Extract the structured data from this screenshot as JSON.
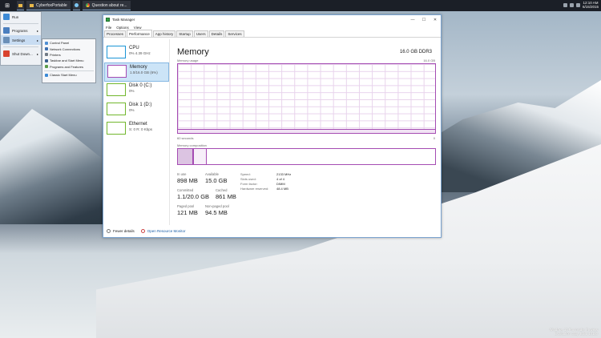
{
  "taskbar": {
    "items": [
      {
        "label": ""
      },
      {
        "label": "CyberfoxPortable"
      },
      {
        "label": "Question about re..."
      }
    ],
    "clock": {
      "time": "12:10 AM",
      "date": "6/15/2015"
    }
  },
  "start_menu": {
    "items": [
      {
        "label": "Run"
      },
      {
        "label": "Programs"
      },
      {
        "label": "Settings"
      },
      {
        "label": "Shut Down..."
      }
    ],
    "arrow": "▸",
    "settings_submenu": [
      {
        "label": "Control Panel"
      },
      {
        "label": "Network Connections"
      },
      {
        "label": "Printers"
      },
      {
        "label": "Taskbar and Start Menu"
      },
      {
        "label": "Programs and Features"
      },
      {
        "label": "Classic Start Menu"
      }
    ]
  },
  "task_manager": {
    "title": "Task Manager",
    "controls": {
      "minimize": "—",
      "maximize": "☐",
      "close": "✕"
    },
    "menu": [
      {
        "label": "File"
      },
      {
        "label": "Options"
      },
      {
        "label": "View"
      }
    ],
    "tabs": [
      {
        "label": "Processes"
      },
      {
        "label": "Performance"
      },
      {
        "label": "App history"
      },
      {
        "label": "Startup"
      },
      {
        "label": "Users"
      },
      {
        "label": "Details"
      },
      {
        "label": "Services"
      }
    ],
    "sidebar": [
      {
        "name": "CPU",
        "value": "0% 4.39 GHz"
      },
      {
        "name": "Memory",
        "value": "1.0/16.0 GB (6%)"
      },
      {
        "name": "Disk 0 (C:)",
        "value": "0%"
      },
      {
        "name": "Disk 1 (D:)",
        "value": "0%"
      },
      {
        "name": "Ethernet",
        "value": "S: 0 R: 0 Kbps"
      }
    ],
    "memory": {
      "title": "Memory",
      "capacity": "16.0 GB DDR3",
      "usage_label": "Memory usage",
      "usage_max": "16.0 GB",
      "usage_fraction": 0.06,
      "time_label": "60 seconds",
      "zero_label": "0",
      "composition_label": "Memory composition",
      "stats": {
        "in_use_label": "In use",
        "in_use": "898 MB",
        "available_label": "Available",
        "available": "15.0 GB",
        "committed_label": "Committed",
        "committed": "1.1/20.0 GB",
        "cached_label": "Cached",
        "cached": "861 MB",
        "paged_label": "Paged pool",
        "paged": "121 MB",
        "nonpaged_label": "Non-paged pool",
        "nonpaged": "94.5 MB"
      },
      "specs": [
        {
          "label": "Speed:",
          "value": "2133 MHz"
        },
        {
          "label": "Slots used:",
          "value": "4 of 4"
        },
        {
          "label": "Form factor:",
          "value": "DIMM"
        },
        {
          "label": "Hardware reserved:",
          "value": "48.4 MB"
        }
      ]
    },
    "footer": {
      "fewer_details": "Fewer details",
      "open_monitor": "Open Resource Monitor"
    }
  },
  "watermark": {
    "line1": "Windows 10 Pro Insider Preview",
    "line2": "Evaluation copy. Build 10130"
  },
  "colors": {
    "memory_accent": "#a54cb3",
    "cpu_accent": "#1b95d6",
    "disk_accent": "#72b72d",
    "selection": "#cce4f7"
  }
}
